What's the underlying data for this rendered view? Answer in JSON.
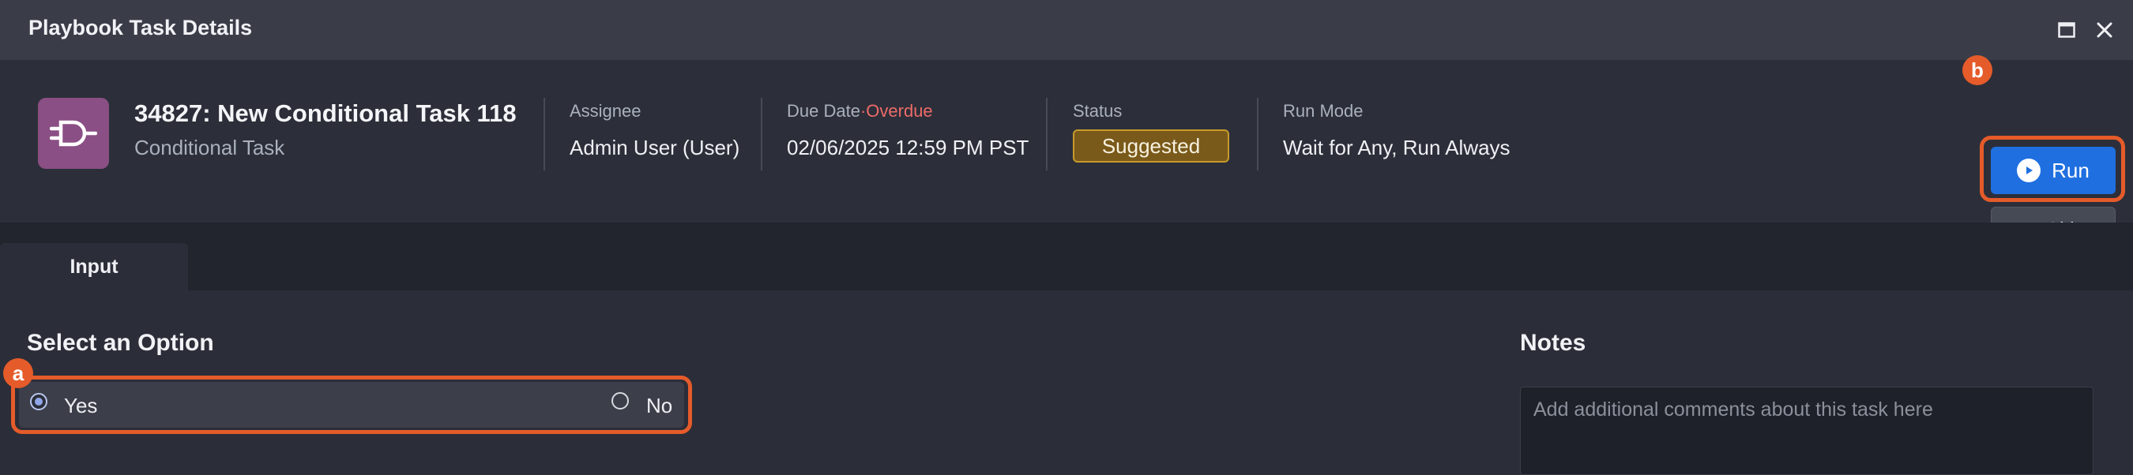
{
  "window": {
    "title": "Playbook Task Details",
    "maximize_icon": "maximize-icon",
    "close_icon": "close-icon"
  },
  "task": {
    "icon": "conditional-plug-icon",
    "icon_color": "#8a4f84",
    "title": "34827: New Conditional Task 118",
    "type": "Conditional Task"
  },
  "fields": {
    "assignee_label": "Assignee",
    "assignee_value": "Admin User (User)",
    "due_label": "Due Date",
    "due_separator": "·",
    "due_status": "Overdue",
    "due_value": "02/06/2025 12:59 PM PST",
    "status_label": "Status",
    "status_value": "Suggested",
    "run_mode_label": "Run Mode",
    "run_mode_value": "Wait for Any, Run Always"
  },
  "actions": {
    "run_label": "Run",
    "skip_label": "Skip",
    "run_color": "#1f6fe0"
  },
  "markers": {
    "a": "a",
    "b": "b",
    "color": "#e55b2a"
  },
  "tabs": [
    {
      "label": "Input",
      "active": true
    }
  ],
  "input": {
    "section_title": "Select an Option",
    "options": [
      {
        "label": "Yes",
        "selected": true
      },
      {
        "label": "No",
        "selected": false
      }
    ]
  },
  "notes": {
    "title": "Notes",
    "placeholder": "Add additional comments about this task here"
  }
}
